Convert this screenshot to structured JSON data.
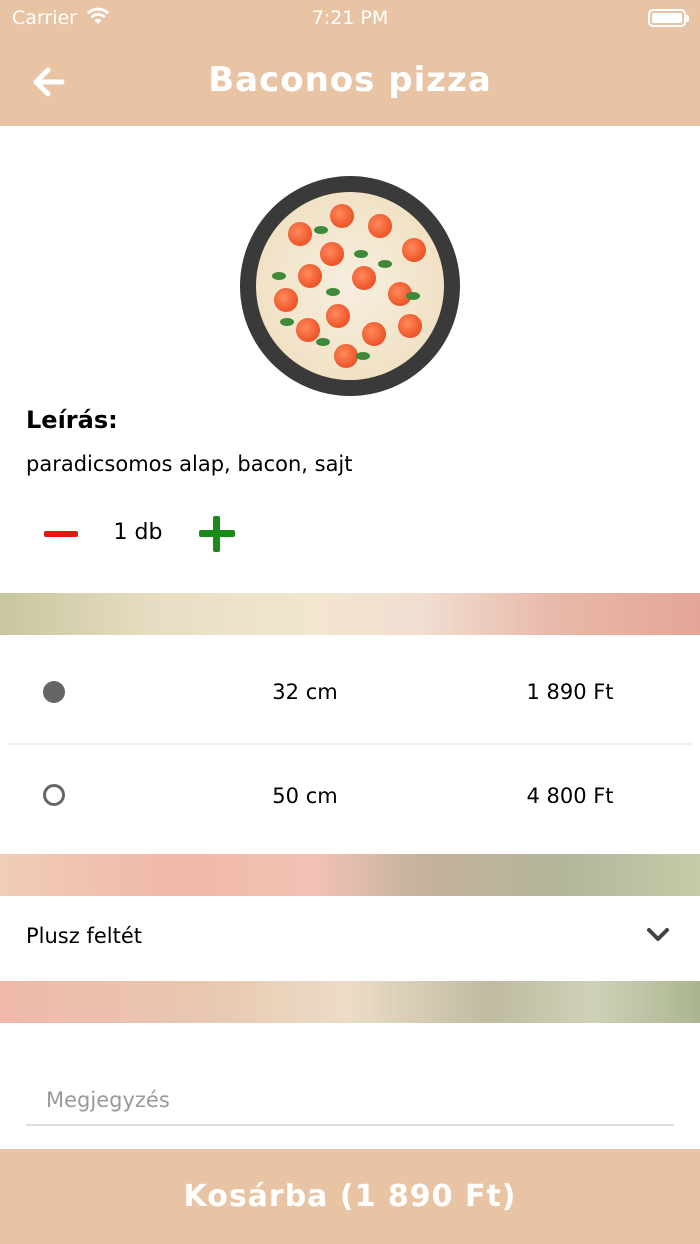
{
  "status_bar": {
    "carrier": "Carrier",
    "time": "7:21 PM"
  },
  "nav": {
    "title": "Baconos pizza",
    "back_icon": "arrow-left-icon"
  },
  "product": {
    "image": "pizza-image",
    "description_label": "Leírás:",
    "description": "paradicsomos alap, bacon, sajt"
  },
  "quantity": {
    "count_text": "1 db",
    "minus_icon": "minus-icon",
    "plus_icon": "plus-icon",
    "minus_color": "#ee1111",
    "plus_color": "#1a8a1a"
  },
  "sizes": [
    {
      "size": "32 cm",
      "price": "1 890 Ft",
      "selected": true
    },
    {
      "size": "50 cm",
      "price": "4 800 Ft",
      "selected": false
    }
  ],
  "extras": {
    "label": "Plusz feltét",
    "icon": "chevron-down-icon"
  },
  "note": {
    "placeholder": "Megjegyzés",
    "value": ""
  },
  "cart_button": {
    "label": "Kosárba (1 890 Ft)"
  },
  "colors": {
    "accent": "#e8c4a4"
  }
}
